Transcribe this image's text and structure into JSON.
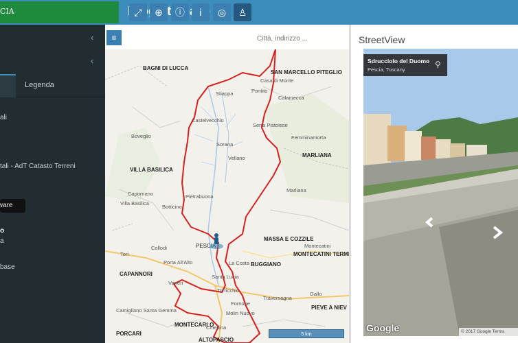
{
  "header": {
    "brand_fragment": "CIA",
    "app_title": "Progetto base"
  },
  "sidebar": {
    "tab_legend": "Legenda",
    "items": [
      "ali",
      "tali - AdT Catasto Terreni",
      "o",
      "a",
      "base"
    ],
    "tooltip": "tware"
  },
  "map": {
    "search_placeholder": "Città, indirizzo ...",
    "places": [
      "BAGNI DI LUCCA",
      "SAN MARCELLO PITEGLIO",
      "VILLA BASILICA",
      "MARLIANA",
      "MASSA E COZZILE",
      "MONTECATINI TERME",
      "BUGGIANO",
      "CAPANNORI",
      "PIEVE A NIEV",
      "MONTECARLO",
      "PORCARI",
      "ALTOPASCIO",
      "PESCIA"
    ],
    "towns": [
      "Stiappa",
      "Pontito",
      "Casa di Monte",
      "Calamecca",
      "Castelvecchio",
      "Boveglio",
      "Serra Pistoiese",
      "Femminamorta",
      "Sorana",
      "Vellano",
      "Capornano",
      "Villa Basilica",
      "Pietrabuona",
      "Botticino",
      "Marliana",
      "Collodi",
      "Porta All'Alto",
      "Veneri",
      "Tori",
      "La Costa",
      "Santa Lucia",
      "Torricchio",
      "Fornone",
      "Traversagna",
      "Molin Nuovo",
      "Montecatini",
      "Chiesina",
      "Camigliano Santa Gemma",
      "Gallo"
    ],
    "scale_label": "5 km"
  },
  "streetview": {
    "heading": "StreetView",
    "street": "Sdrucciolo del Duomo",
    "city": "Pescia, Tuscany",
    "google_logo": "Google",
    "copyright": "© 2017 Google   Terms"
  },
  "colors": {
    "topbar": "#3c8dbc",
    "brand": "#1e8a3e",
    "sidebar": "#222d32",
    "boundary": "#d7201e"
  }
}
